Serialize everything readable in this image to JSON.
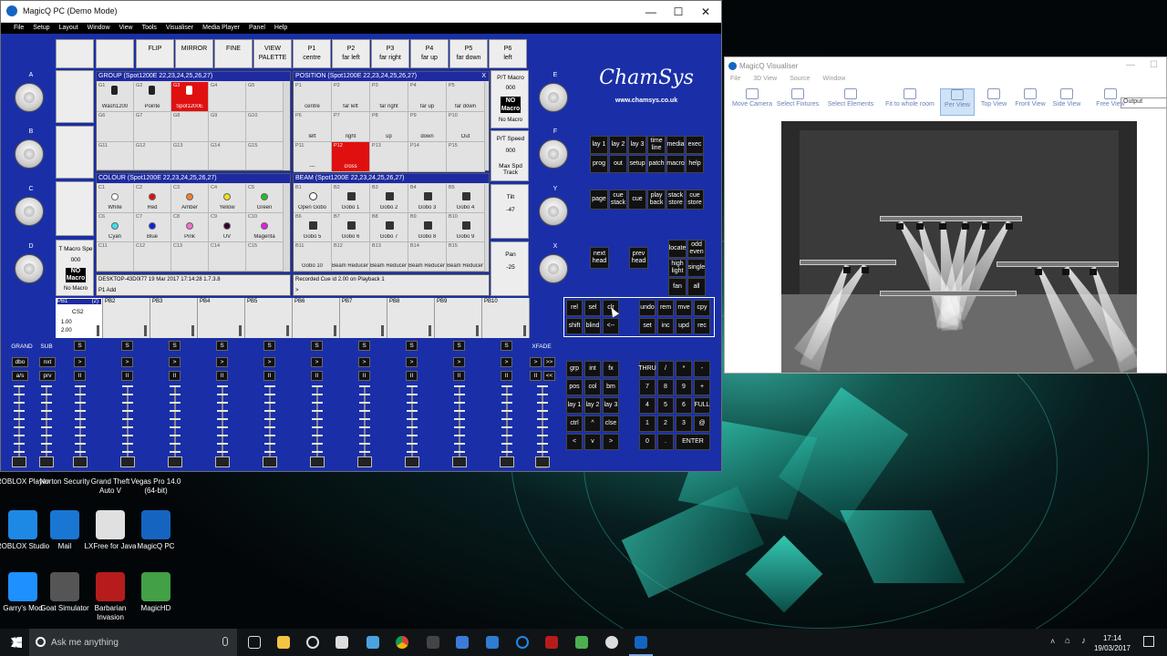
{
  "app": {
    "title": "MagicQ PC (Demo Mode)",
    "menu": [
      "File",
      "Setup",
      "Layout",
      "Window",
      "View",
      "Tools",
      "Visualiser",
      "Media Player",
      "Panel",
      "Help"
    ]
  },
  "window_controls": {
    "minimize": "—",
    "maximize": "☐",
    "close": "✕"
  },
  "softkeys": [
    "FLIP",
    "MIRROR",
    "FINE",
    "VIEW\nPALETTE",
    "P1\ncentre",
    "P2\nfar left",
    "P3\nfar right",
    "P4\nfar up",
    "P5\nfar down",
    "P6\nleft"
  ],
  "encoders": {
    "left": [
      "A",
      "B",
      "C",
      "D"
    ],
    "right": [
      "E",
      "F",
      "Y",
      "X"
    ]
  },
  "group": {
    "title": "GROUP (Spot1200E 22,23,24,25,26,27)",
    "row1": [
      {
        "i": "G1",
        "l": "Wash1200"
      },
      {
        "i": "G2",
        "l": "Pointe"
      },
      {
        "i": "G3",
        "l": "Spot1200E"
      },
      {
        "i": "G4",
        "l": ""
      },
      {
        "i": "G5",
        "l": ""
      }
    ],
    "row2": [
      "G6",
      "G7",
      "G8",
      "G9",
      "G10"
    ],
    "row3": [
      "G11",
      "G12",
      "G13",
      "G14",
      "G15"
    ]
  },
  "position": {
    "title": "POSITION (Spot1200E 22,23,24,25,26,27)",
    "close": "X",
    "cells": [
      {
        "i": "P1",
        "l": "centre"
      },
      {
        "i": "P2",
        "l": "far left"
      },
      {
        "i": "P3",
        "l": "far right"
      },
      {
        "i": "P4",
        "l": "far up"
      },
      {
        "i": "P5",
        "l": "far down"
      },
      {
        "i": "P6",
        "l": "left"
      },
      {
        "i": "P7",
        "l": "right"
      },
      {
        "i": "P8",
        "l": "up"
      },
      {
        "i": "P9",
        "l": "down"
      },
      {
        "i": "P10",
        "l": "Out"
      },
      {
        "i": "P11",
        "l": "---"
      },
      {
        "i": "P12",
        "l": "cross"
      },
      {
        "i": "P13",
        "l": ""
      },
      {
        "i": "P14",
        "l": ""
      },
      {
        "i": "P15",
        "l": ""
      }
    ]
  },
  "colour": {
    "title": "COLOUR (Spot1200E 22,23,24,25,26,27)",
    "cells": [
      {
        "i": "C1",
        "l": "White",
        "c": "#ffffff"
      },
      {
        "i": "C2",
        "l": "Red",
        "c": "#e01010"
      },
      {
        "i": "C3",
        "l": "Amber",
        "c": "#f08030"
      },
      {
        "i": "C4",
        "l": "Yellow",
        "c": "#f0e020"
      },
      {
        "i": "C5",
        "l": "Green",
        "c": "#20c020"
      },
      {
        "i": "C6",
        "l": "Cyan",
        "c": "#40e0f0"
      },
      {
        "i": "C7",
        "l": "Blue",
        "c": "#1020e0"
      },
      {
        "i": "C8",
        "l": "Pink",
        "c": "#f070d0"
      },
      {
        "i": "C9",
        "l": "UV",
        "c": "#300030"
      },
      {
        "i": "C10",
        "l": "Magenta",
        "c": "#e020e0"
      },
      {
        "i": "C11",
        "l": "",
        "c": ""
      },
      {
        "i": "C12",
        "l": "",
        "c": ""
      },
      {
        "i": "C13",
        "l": "",
        "c": ""
      },
      {
        "i": "C14",
        "l": "",
        "c": ""
      },
      {
        "i": "C15",
        "l": "",
        "c": ""
      }
    ]
  },
  "beam": {
    "title": "BEAM (Spot1200E 22,23,24,25,26,27)",
    "cells": [
      {
        "i": "B1",
        "l": "Open Gobo"
      },
      {
        "i": "B2",
        "l": "Gobo 1"
      },
      {
        "i": "B3",
        "l": "Gobo 2"
      },
      {
        "i": "B4",
        "l": "Gobo 3"
      },
      {
        "i": "B5",
        "l": "Gobo 4"
      },
      {
        "i": "B6",
        "l": "Gobo 5"
      },
      {
        "i": "B7",
        "l": "Gobo 6"
      },
      {
        "i": "B8",
        "l": "Gobo 7"
      },
      {
        "i": "B9",
        "l": "Gobo 8"
      },
      {
        "i": "B10",
        "l": "Gobo 9"
      },
      {
        "i": "B11",
        "l": "Gobo 10"
      },
      {
        "i": "B12",
        "l": "Beam Reducer 1"
      },
      {
        "i": "B13",
        "l": "Beam Reducer 2"
      },
      {
        "i": "B14",
        "l": "Beam Reducer 3"
      },
      {
        "i": "B15",
        "l": "Beam Reducer 4"
      }
    ]
  },
  "side": {
    "pt_macro": "P/T Macro",
    "pt_macro_val": "000",
    "no_macro": "NO Macro",
    "no_macro_lbl": "No Macro",
    "pt_speed": "P/T Speed",
    "pt_speed_val": "000",
    "max_spd": "Max Spd Track",
    "tilt": "Tilt",
    "tilt_val": "-47",
    "pan": "Pan",
    "pan_val": "-25",
    "t_macro": "T Macro Spe",
    "t_macro_val": "000"
  },
  "status": {
    "host": "DESKTOP-43D0I77 19 Mar 2017 17:14:28 1.7.3.8",
    "cmd": "P1  Add",
    "msg": "Recorded Cue id 2.00 on Playback 1",
    "prompt": ">"
  },
  "playbacks": [
    {
      "n": "PB1",
      "tag": "(2)",
      "sub": "CS2",
      "a": "1.00",
      "b": "2.00"
    },
    {
      "n": "PB2"
    },
    {
      "n": "PB3"
    },
    {
      "n": "PB4"
    },
    {
      "n": "PB5"
    },
    {
      "n": "PB6"
    },
    {
      "n": "PB7"
    },
    {
      "n": "PB8"
    },
    {
      "n": "PB9"
    },
    {
      "n": "PB10"
    }
  ],
  "faders": {
    "grand": "GRAND",
    "sub": "SUB",
    "xfade": "XFADE",
    "dbo": "dbo",
    "nxt": "nxt",
    "as": "a/s",
    "prv": "prv",
    "s": "S",
    "go": ">",
    "pause": "II",
    "ff": ">>",
    "rew": "<<",
    "step": ">"
  },
  "brand": {
    "logo": "ChamSys",
    "url": "www.chamsys.co.uk"
  },
  "keys": {
    "top": [
      [
        "lay 1",
        "lay 2",
        "lay 3",
        "time line",
        "media",
        "exec"
      ],
      [
        "prog",
        "out",
        "setup",
        "patch",
        "macro",
        "help"
      ]
    ],
    "mid": [
      "page",
      "cue stack",
      "cue",
      "play back",
      "stack store",
      "cue store"
    ],
    "head": [
      "next head",
      "prev head"
    ],
    "sel": [
      "locate",
      "odd even",
      "high light",
      "single",
      "fan",
      "all"
    ],
    "edit": [
      [
        "rel",
        "sel",
        "clr",
        "undo",
        "rem",
        "mve",
        "cpy"
      ],
      [
        "shift",
        "blind",
        "<--",
        "set",
        "inc",
        "upd",
        "rec"
      ]
    ],
    "pad": [
      [
        "grp",
        "int",
        "fx"
      ],
      [
        "pos",
        "col",
        "bm"
      ],
      [
        "lay 1",
        "lay 2",
        "lay 3"
      ],
      [
        "ctrl",
        "^",
        "clse"
      ],
      [
        "<",
        "v",
        ">"
      ]
    ],
    "num": [
      [
        "THRU",
        "/",
        "*",
        "-"
      ],
      [
        "7",
        "8",
        "9",
        "+"
      ],
      [
        "4",
        "5",
        "6",
        "FULL"
      ],
      [
        "1",
        "2",
        "3",
        "@"
      ],
      [
        "0",
        ".",
        "ENTER"
      ]
    ]
  },
  "visualiser": {
    "title": "MagicQ Visualiser",
    "menu": [
      "File",
      "3D View",
      "Source",
      "Window"
    ],
    "tools": [
      "Move Camera",
      "Select Fixtures",
      "Select Elements",
      "Fit to whole room",
      "Per View",
      "Top View",
      "Front View",
      "Side View",
      "Free View"
    ],
    "mode": "Output"
  },
  "desktop": [
    {
      "l": "ROBLOX Player",
      "c": "#d33"
    },
    {
      "l": "Norton Security",
      "c": "#f2c200"
    },
    {
      "l": "Grand Theft Auto V",
      "c": "#2a6"
    },
    {
      "l": "Vegas Pro 14.0 (64-bit)",
      "c": "#36c"
    },
    {
      "l": "ROBLOX Studio",
      "c": "#1e88e5"
    },
    {
      "l": "Mail",
      "c": "#1976d2"
    },
    {
      "l": "LXFree for Java",
      "c": "#e0e0e0"
    },
    {
      "l": "MagicQ PC",
      "c": "#1565c0"
    },
    {
      "l": "Garry's Mod",
      "c": "#1e90ff"
    },
    {
      "l": "Goat Simulator",
      "c": "#555"
    },
    {
      "l": "Barbarian Invasion",
      "c": "#b71c1c"
    },
    {
      "l": "MagicHD",
      "c": "#43a047"
    }
  ],
  "taskbar": {
    "search": "Ask me anything",
    "time": "17:14",
    "date": "19/03/2017"
  },
  "colors": {
    "panel": "#1a2fa7",
    "header": "#1e2aa0",
    "select": "#e01010"
  }
}
